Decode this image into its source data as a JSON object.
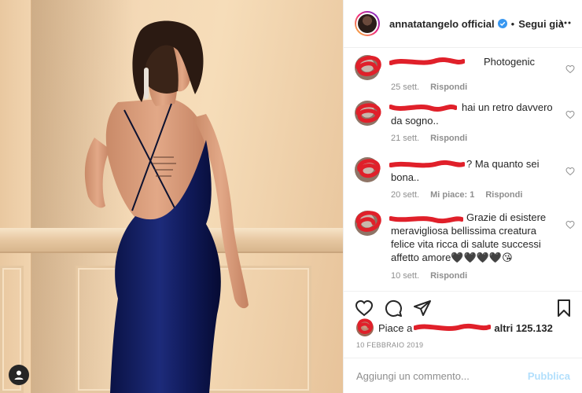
{
  "post": {
    "username": "annatatangelo official",
    "follow_label": "Segui già",
    "separator": "•"
  },
  "comments": [
    {
      "text": "Photogenic",
      "time": "25 sett.",
      "reply": "Rispondi",
      "likes": ""
    },
    {
      "text": "hai un retro davvero da sogno..",
      "time": "21 sett.",
      "reply": "Rispondi",
      "likes": ""
    },
    {
      "text": "? Ma quanto sei bona..",
      "time": "20 sett.",
      "reply": "Rispondi",
      "likes": "Mi piace: 1"
    },
    {
      "text": "Grazie di esistere meravigliosa bellissima creatura felice vita ricca di salute successi affetto amore🖤🖤🖤🖤😘",
      "time": "10 sett.",
      "reply": "Rispondi",
      "likes": ""
    }
  ],
  "likes": {
    "prefix": "Piace a",
    "others": "altri 125.132"
  },
  "date": "10 FEBBRAIO 2019",
  "composer": {
    "placeholder": "Aggiungi un commento...",
    "publish_label": "Pubblica"
  },
  "icons": {
    "verified": "verified-badge-icon",
    "more": "more-options-icon",
    "heart": "heart-icon",
    "comment": "comment-icon",
    "share": "share-icon",
    "save": "bookmark-icon",
    "user_tag": "user-tag-icon"
  },
  "colors": {
    "verified": "#3897f0",
    "redaction": "#e0202a",
    "dress": "#0f1a55",
    "publish_disabled": "#b2dffc"
  }
}
